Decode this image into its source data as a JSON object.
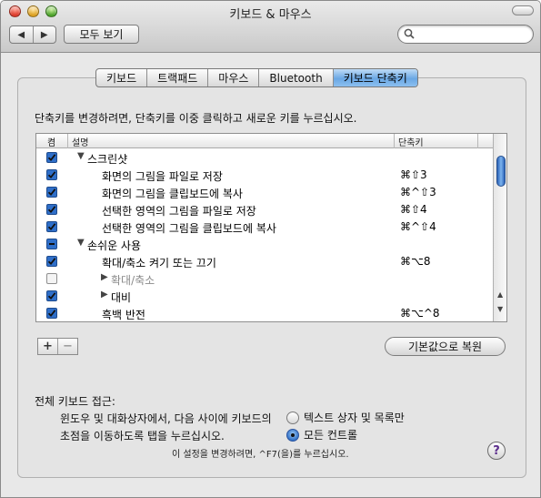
{
  "window": {
    "title": "키보드 & 마우스"
  },
  "toolbar": {
    "back_glyph": "◀",
    "forward_glyph": "▶",
    "show_all": "모두 보기",
    "search_value": ""
  },
  "tabs": [
    {
      "label": "키보드",
      "active": false
    },
    {
      "label": "트랙패드",
      "active": false
    },
    {
      "label": "마우스",
      "active": false
    },
    {
      "label": "Bluetooth",
      "active": false
    },
    {
      "label": "키보드 단축키",
      "active": true
    }
  ],
  "instruction": "단축키를 변경하려면, 단축키를 이중 클릭하고 새로운 키를 누르십시오.",
  "table": {
    "col_on": "켬",
    "col_desc": "설명",
    "col_key": "단축키",
    "rows": [
      {
        "state": "checked",
        "indent": 0,
        "expander": "▼",
        "label": "스크린샷",
        "key": ""
      },
      {
        "state": "checked",
        "indent": 1,
        "expander": "",
        "label": "화면의 그림을 파일로 저장",
        "key": "⌘⇧3"
      },
      {
        "state": "checked",
        "indent": 1,
        "expander": "",
        "label": "화면의 그림을 클립보드에 복사",
        "key": "⌘^⇧3"
      },
      {
        "state": "checked",
        "indent": 1,
        "expander": "",
        "label": "선택한 영역의 그림을 파일로 저장",
        "key": "⌘⇧4"
      },
      {
        "state": "checked",
        "indent": 1,
        "expander": "",
        "label": "선택한 영역의 그림을 클립보드에 복사",
        "key": "⌘^⇧4"
      },
      {
        "state": "mixed",
        "indent": 0,
        "expander": "▼",
        "label": "손쉬운 사용",
        "key": ""
      },
      {
        "state": "checked",
        "indent": 1,
        "expander": "",
        "label": "확대/축소 켜기 또는 끄기",
        "key": "⌘⌥8"
      },
      {
        "state": "unchecked",
        "indent": 1,
        "expander": "▶",
        "label": "확대/축소",
        "key": "",
        "dim": true
      },
      {
        "state": "checked",
        "indent": 1,
        "expander": "▶",
        "label": "대비",
        "key": ""
      },
      {
        "state": "checked",
        "indent": 1,
        "expander": "",
        "label": "흑백 반전",
        "key": "⌘⌥^8"
      }
    ]
  },
  "controls": {
    "plus": "+",
    "minus": "−",
    "restore": "기본값으로 복원"
  },
  "full_keyboard": {
    "heading": "전체 키보드 접근:",
    "description": "윈도우 및 대화상자에서, 다음 사이에 키보드의 초점을 이동하도록 탭을 누르십시오.",
    "option_text_lists": "텍스트 상자 및 목록만",
    "option_all": "모든 컨트롤",
    "selected": "option_all",
    "hint": "이 설정을 변경하려면, ^F7(을)를 누르십시오."
  },
  "help": "?"
}
